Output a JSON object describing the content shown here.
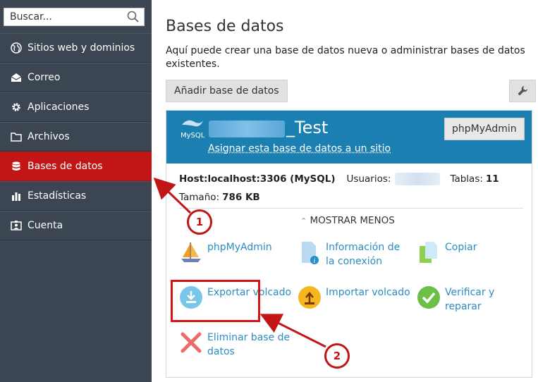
{
  "sidebar": {
    "search": {
      "placeholder": "Buscar..."
    },
    "items": [
      {
        "label": "Sitios web y dominios",
        "icon": "globe-icon"
      },
      {
        "label": "Correo",
        "icon": "mail-icon"
      },
      {
        "label": "Aplicaciones",
        "icon": "gear-icon"
      },
      {
        "label": "Archivos",
        "icon": "folder-icon"
      },
      {
        "label": "Bases de datos",
        "icon": "database-icon",
        "active": true
      },
      {
        "label": "Estadísticas",
        "icon": "bar-chart-icon"
      },
      {
        "label": "Cuenta",
        "icon": "id-card-icon"
      }
    ]
  },
  "main": {
    "title": "Bases de datos",
    "description": "Aquí puede crear una base de datos nueva o administrar bases de datos existentes.",
    "add_button": "Añadir base de datos",
    "tools_icon": "wrench-icon",
    "database": {
      "name_suffix": "_Test",
      "assign_link": "Asignar esta base de datos a un sitio",
      "phpmyadmin_button": "phpMyAdmin",
      "host_label": "Host:",
      "host_value": "localhost:3306 (MySQL)",
      "users_label": "Usuarios:",
      "tables_label": "Tablas:",
      "tables_value": "11",
      "size_label": "Tamaño:",
      "size_value": "786 KB",
      "show_less": "MOSTRAR MENOS",
      "actions": [
        {
          "label": "phpMyAdmin",
          "icon": "sailboat-icon"
        },
        {
          "label": "Información de la conexión",
          "icon": "info-document-icon"
        },
        {
          "label": "Copiar",
          "icon": "copy-icon"
        },
        {
          "label": "Exportar volcado",
          "icon": "download-icon"
        },
        {
          "label": "Importar volcado",
          "icon": "upload-icon"
        },
        {
          "label": "Verificar y reparar",
          "icon": "check-icon"
        },
        {
          "label": "Eliminar base de datos",
          "icon": "delete-x-icon"
        }
      ]
    }
  },
  "annotations": {
    "badge_1": "1",
    "badge_2": "2"
  },
  "colors": {
    "sidebar_bg": "#3b4652",
    "active_red": "#c21616",
    "header_blue": "#1b7fb2",
    "link_blue": "#2a8dc6"
  }
}
